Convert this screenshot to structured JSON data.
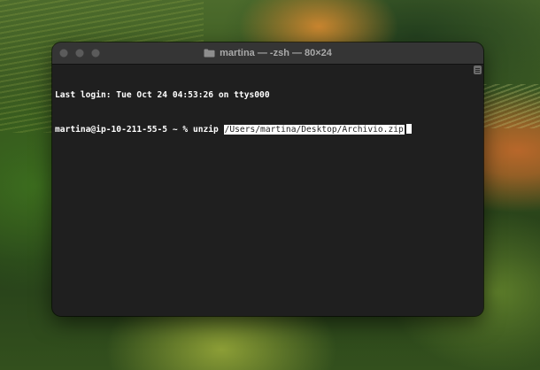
{
  "window": {
    "title": "martina — -zsh — 80×24",
    "title_icon": "folder-icon",
    "traffic_lights": [
      "close",
      "minimize",
      "zoom"
    ]
  },
  "terminal": {
    "last_login_line": "Last login: Tue Oct 24 04:53:26 on ttys000",
    "prompt": "martina@ip-10-211-55-5 ~ % ",
    "command": "unzip ",
    "selected_path": "/Users/martina/Desktop/Archivio.zip"
  },
  "colors": {
    "terminal_background": "#1f1f1f",
    "title_bar": "#353535",
    "text": "#ffffff"
  }
}
